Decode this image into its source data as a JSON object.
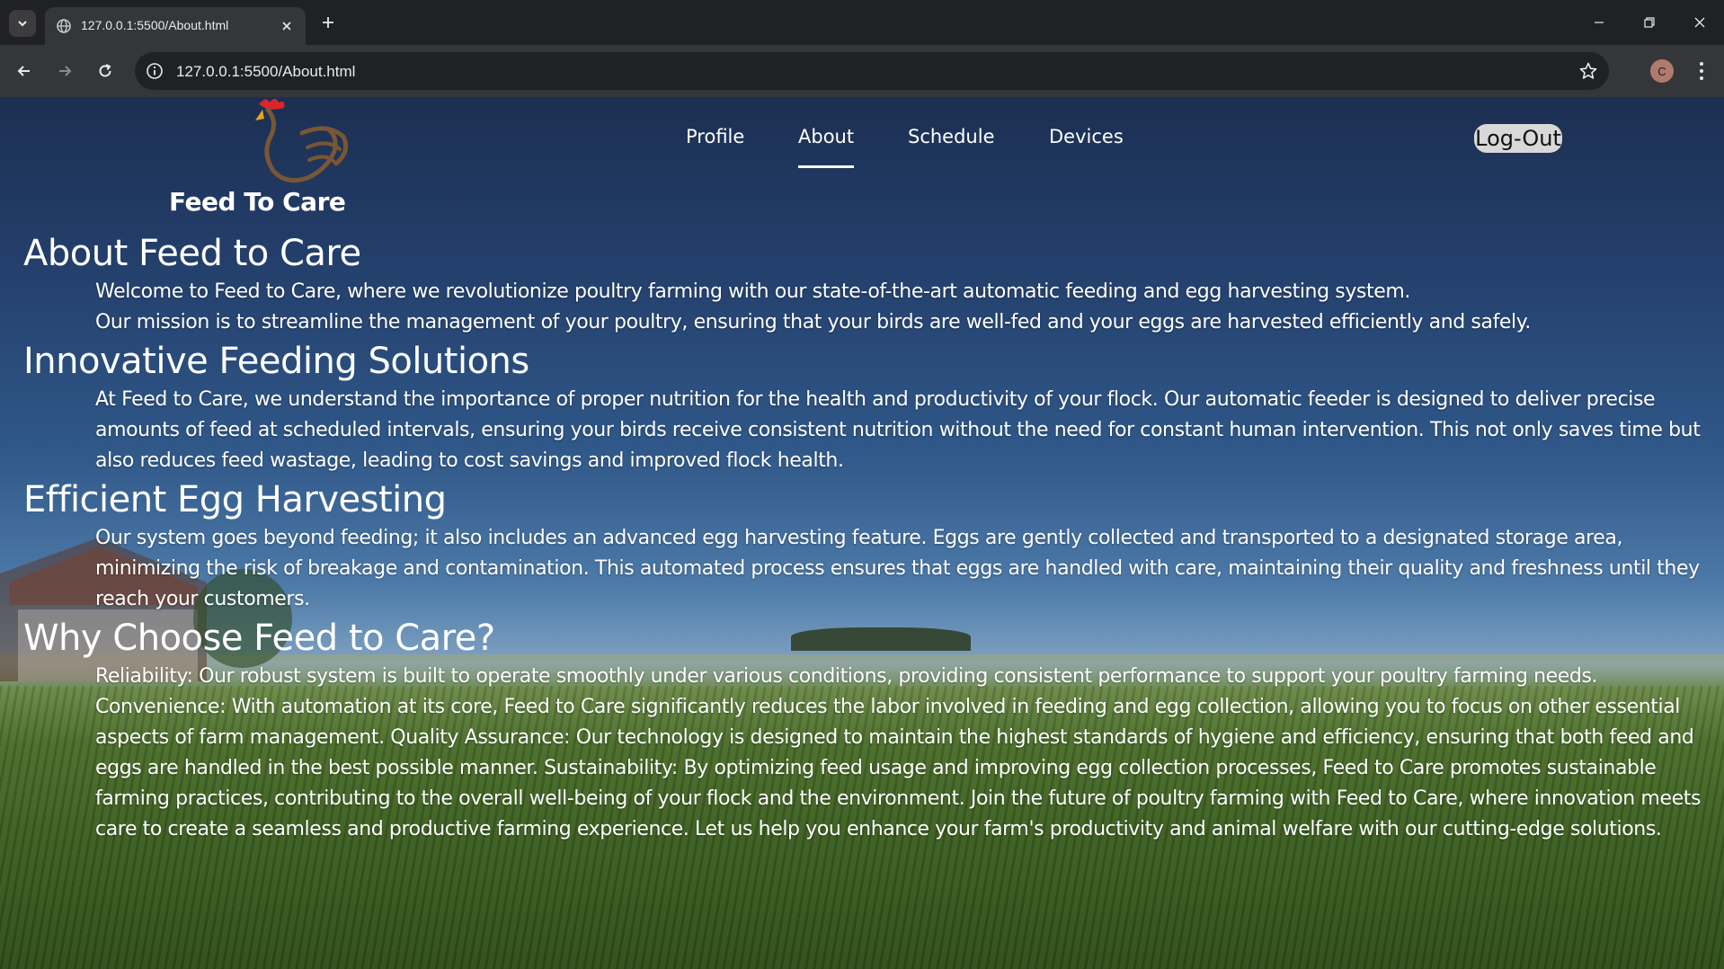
{
  "browser": {
    "tab_title": "127.0.0.1:5500/About.html",
    "url": "127.0.0.1:5500/About.html",
    "profile_initial": "C",
    "icons": {
      "tab_list": "chevron-down-icon",
      "favicon": "globe-icon",
      "tab_close": "close-icon",
      "new_tab": "plus-icon",
      "minimize": "minimize-icon",
      "restore": "restore-icon",
      "close_window": "close-icon",
      "back": "arrow-left-icon",
      "forward": "arrow-right-icon",
      "reload": "reload-icon",
      "site_info": "info-icon",
      "bookmark": "star-icon",
      "menu": "kebab-menu-icon"
    }
  },
  "site": {
    "brand_name": "Feed To Care",
    "logo_icon": "rooster-icon",
    "nav": {
      "items": [
        {
          "label": "Profile",
          "active": false
        },
        {
          "label": "About",
          "active": true
        },
        {
          "label": "Schedule",
          "active": false
        },
        {
          "label": "Devices",
          "active": false
        }
      ],
      "logout_label": "Log-Out"
    }
  },
  "sections": [
    {
      "heading": "About Feed to Care",
      "paragraphs": [
        "Welcome to Feed to Care, where we revolutionize poultry farming with our state-of-the-art automatic feeding and egg harvesting system.",
        "Our mission is to streamline the management of your poultry, ensuring that your birds are well-fed and your eggs are harvested efficiently and safely."
      ]
    },
    {
      "heading": "Innovative Feeding Solutions",
      "paragraphs": [
        "At Feed to Care, we understand the importance of proper nutrition for the health and productivity of your flock. Our automatic feeder is designed to deliver precise amounts of feed at scheduled intervals, ensuring your birds receive consistent nutrition without the need for constant human intervention. This not only saves time but also reduces feed wastage, leading to cost savings and improved flock health."
      ]
    },
    {
      "heading": "Efficient Egg Harvesting",
      "paragraphs": [
        "Our system goes beyond feeding; it also includes an advanced egg harvesting feature. Eggs are gently collected and transported to a designated storage area, minimizing the risk of breakage and contamination. This automated process ensures that eggs are handled with care, maintaining their quality and freshness until they reach your customers."
      ]
    },
    {
      "heading": "Why Choose Feed to Care?",
      "paragraphs": [
        "Reliability: Our robust system is built to operate smoothly under various conditions, providing consistent performance to support your poultry farming needs. Convenience: With automation at its core, Feed to Care significantly reduces the labor involved in feeding and egg collection, allowing you to focus on other essential aspects of farm management. Quality Assurance: Our technology is designed to maintain the highest standards of hygiene and efficiency, ensuring that both feed and eggs are handled in the best possible manner. Sustainability: By optimizing feed usage and improving egg collection processes, Feed to Care promotes sustainable farming practices, contributing to the overall well-being of your flock and the environment. Join the future of poultry farming with Feed to Care, where innovation meets care to create a seamless and productive farming experience. Let us help you enhance your farm's productivity and animal welfare with our cutting-edge solutions."
      ]
    }
  ]
}
